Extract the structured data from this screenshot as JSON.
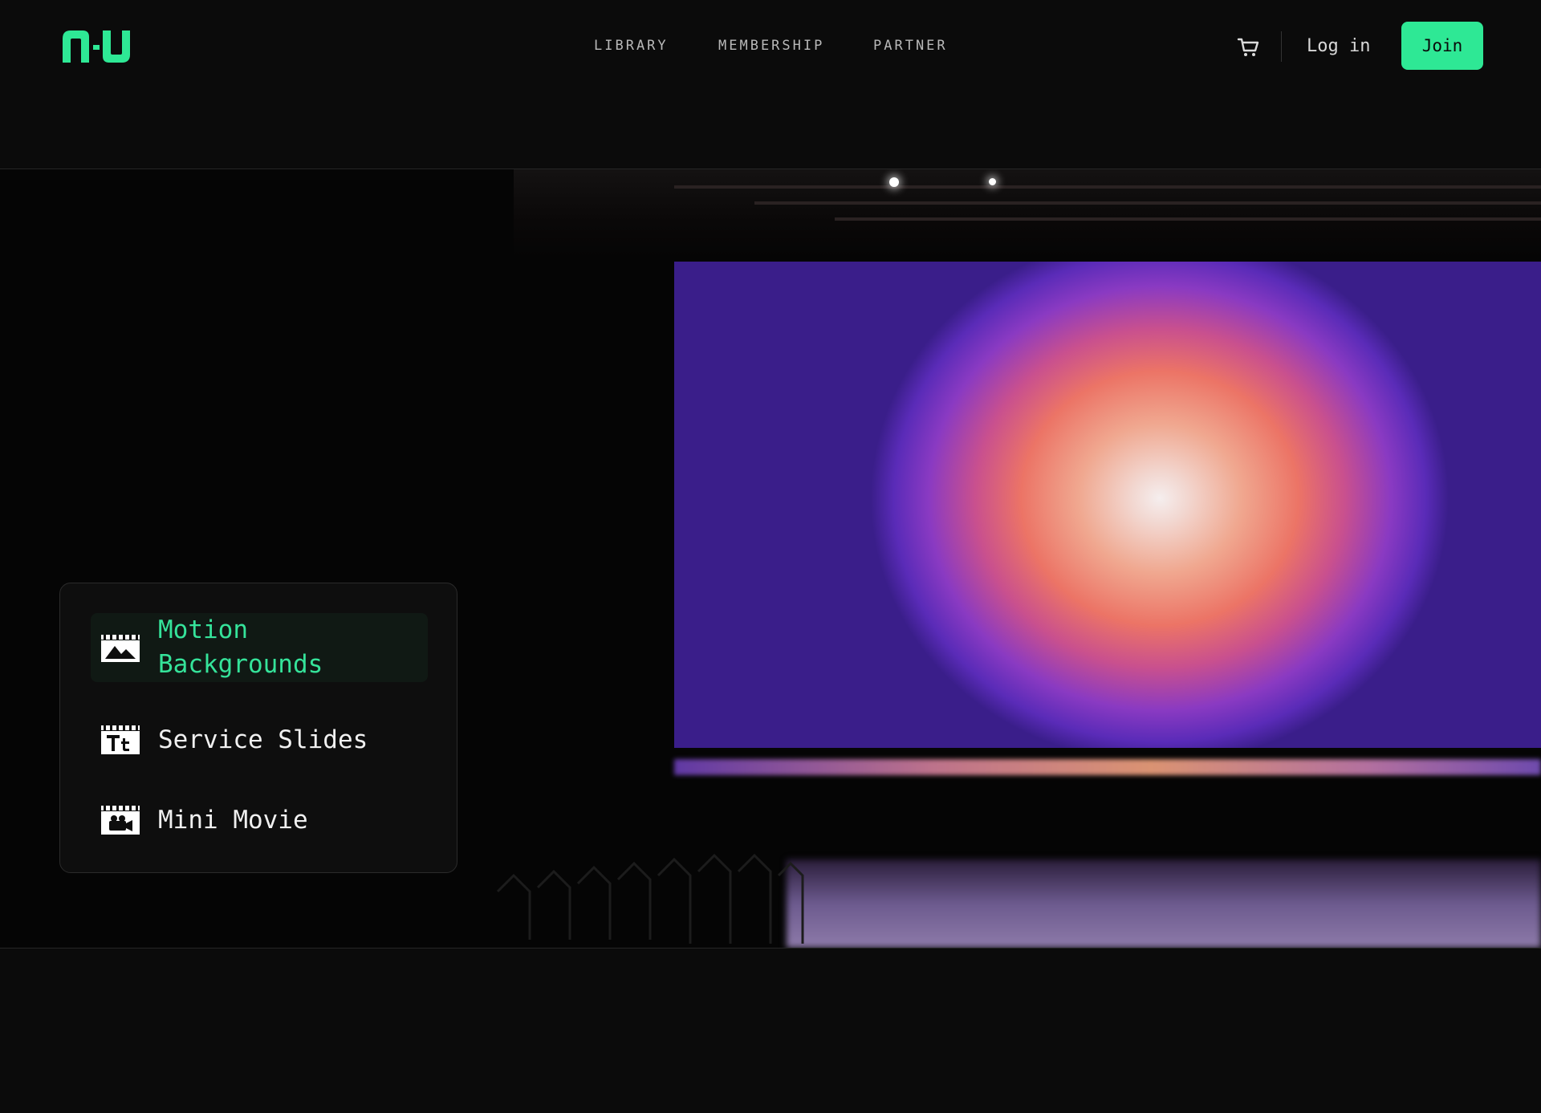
{
  "header": {
    "logo_text": "nu",
    "nav": [
      {
        "label": "LIBRARY"
      },
      {
        "label": "MEMBERSHIP"
      },
      {
        "label": "PARTNER"
      }
    ],
    "cart_icon": "cart-icon",
    "login_label": "Log in",
    "join_label": "Join"
  },
  "menu": {
    "items": [
      {
        "label": "Motion\nBackgrounds",
        "icon": "clapper-landscape-icon",
        "active": true
      },
      {
        "label": "Service Slides",
        "icon": "clapper-text-icon",
        "active": false
      },
      {
        "label": "Mini Movie",
        "icon": "clapper-camera-icon",
        "active": false
      }
    ]
  },
  "colors": {
    "accent": "#2ee895",
    "background": "#0b0b0b",
    "active_text": "#35e39a"
  }
}
